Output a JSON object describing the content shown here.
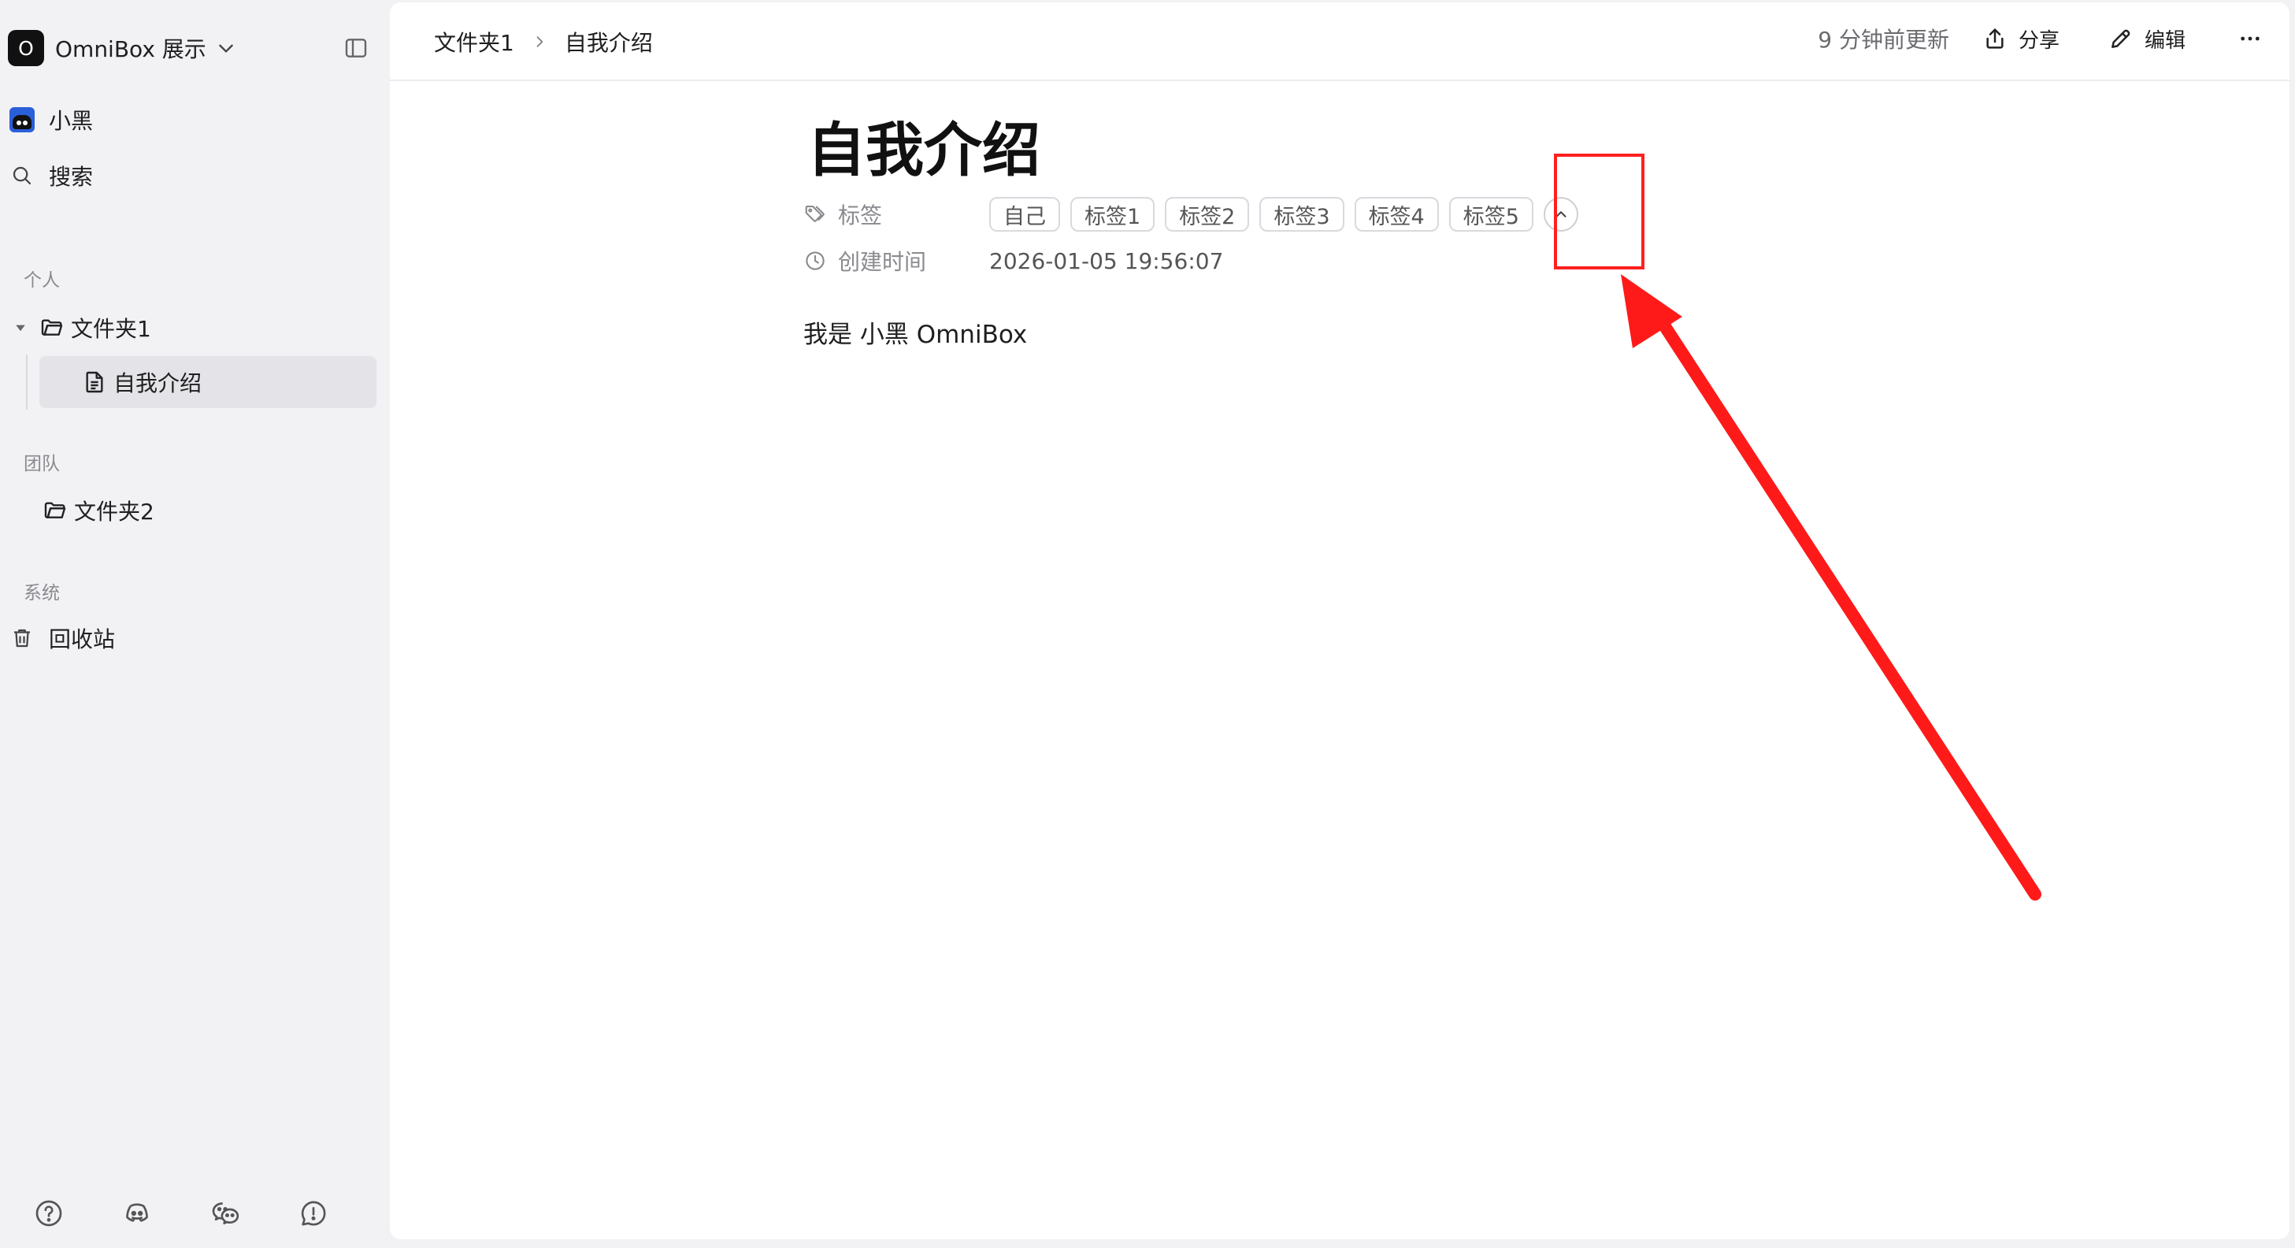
{
  "workspace": {
    "logo_letter": "O",
    "name": "OmniBox 展示"
  },
  "sidebar": {
    "user": {
      "name": "小黑"
    },
    "search_label": "搜索",
    "sections": {
      "personal": "个人",
      "team": "团队",
      "system": "系统"
    },
    "personal_items": [
      {
        "label": "文件夹1",
        "expanded": true,
        "children": [
          {
            "label": "自我介绍",
            "selected": true
          }
        ]
      }
    ],
    "team_items": [
      {
        "label": "文件夹2"
      }
    ],
    "system_items": [
      {
        "label": "回收站"
      }
    ],
    "bottom_icons": [
      "help-icon",
      "discord-icon",
      "wechat-icon",
      "feedback-icon"
    ]
  },
  "header": {
    "breadcrumb": [
      "文件夹1",
      "自我介绍"
    ],
    "updated": "9 分钟前更新",
    "share_label": "分享",
    "edit_label": "编辑"
  },
  "document": {
    "title": "自我介绍",
    "properties": {
      "tags_label": "标签",
      "tags": [
        "自己",
        "标签1",
        "标签2",
        "标签3",
        "标签4",
        "标签5"
      ],
      "created_label": "创建时间",
      "created_value": "2026-01-05 19:56:07"
    },
    "body": "我是 小黑 OmniBox"
  },
  "annotation": {
    "highlight_color": "#ff2020",
    "arrow_color": "#ff1a1a"
  }
}
